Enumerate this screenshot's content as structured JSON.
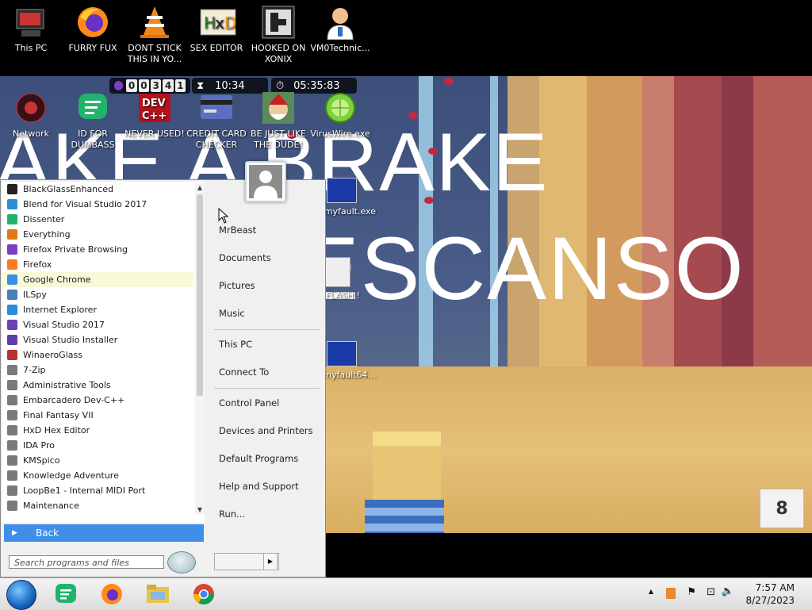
{
  "desktop_top_icons": [
    {
      "label": "This PC",
      "icon": "computer-icon"
    },
    {
      "label": "FURRY FUX",
      "icon": "firefox-icon"
    },
    {
      "label": "DONT STICK THIS IN YO...",
      "icon": "vlc-cone-icon"
    },
    {
      "label": "SEX EDITOR",
      "icon": "hex-editor-icon"
    },
    {
      "label": "HOOKED ON XONIX",
      "icon": "game-icon"
    },
    {
      "label": "VM0Technic...",
      "icon": "doctor-icon"
    }
  ],
  "desktop_mid_icons": [
    {
      "label": "Network",
      "icon": "network-icon"
    },
    {
      "label": "ID FOR DUMBASS",
      "icon": "chat-icon"
    },
    {
      "label": "NEVER USED!",
      "icon": "devcpp-icon"
    },
    {
      "label": "CREDIT CARD CHECKER",
      "icon": "card-icon"
    },
    {
      "label": "BE JUST LIKE THE DUDE!",
      "icon": "santa-icon"
    },
    {
      "label": "VirusWire.exe",
      "icon": "limewire-icon"
    }
  ],
  "desktop_right_icons": [
    {
      "label": "myfault.exe"
    },
    {
      "label": "FLASH !"
    },
    {
      "label": "myfault64..."
    }
  ],
  "game": {
    "banner_line1": "AKE A BRAKE",
    "banner_line2": "ESCANSO",
    "counter_digits": [
      "0",
      "0",
      "3",
      "4",
      "1"
    ],
    "timer": "10:34",
    "elapsed": "05:35:83",
    "corner_number": "8"
  },
  "start_menu": {
    "programs": [
      {
        "label": "BlackGlassEnhanced",
        "color": "#222222"
      },
      {
        "label": "Blend for Visual Studio 2017",
        "color": "#2c8fd6"
      },
      {
        "label": "Dissenter",
        "color": "#21b36b"
      },
      {
        "label": "Everything",
        "color": "#e07a14"
      },
      {
        "label": "Firefox Private Browsing",
        "color": "#7b3fc4"
      },
      {
        "label": "Firefox",
        "color": "#ff7a1a"
      },
      {
        "label": "Google Chrome",
        "color": "#3b8ee8"
      },
      {
        "label": "ILSpy",
        "color": "#4a7fb8"
      },
      {
        "label": "Internet Explorer",
        "color": "#2a8bd8"
      },
      {
        "label": "Visual Studio 2017",
        "color": "#6a3fb8"
      },
      {
        "label": "Visual Studio Installer",
        "color": "#5b3fa8"
      },
      {
        "label": "WinaeroGlass",
        "color": "#b83030"
      },
      {
        "label": "7-Zip",
        "color": "#7a7a7a"
      },
      {
        "label": "Administrative Tools",
        "color": "#7a7a7a"
      },
      {
        "label": "Embarcadero Dev-C++",
        "color": "#7a7a7a"
      },
      {
        "label": "Final Fantasy VII",
        "color": "#7a7a7a"
      },
      {
        "label": "HxD Hex Editor",
        "color": "#7a7a7a"
      },
      {
        "label": "IDA Pro",
        "color": "#7a7a7a"
      },
      {
        "label": "KMSpico",
        "color": "#7a7a7a"
      },
      {
        "label": "Knowledge Adventure",
        "color": "#7a7a7a"
      },
      {
        "label": "LoopBe1 - Internal MIDI Port",
        "color": "#7a7a7a"
      },
      {
        "label": "Maintenance",
        "color": "#7a7a7a"
      }
    ],
    "highlighted_program": "Google Chrome",
    "back_label": "Back",
    "search_placeholder": "Search programs and files",
    "right_items": [
      "MrBeast",
      "Documents",
      "Pictures",
      "Music",
      "This PC",
      "Connect To",
      "Control Panel",
      "Devices and Printers",
      "Default Programs",
      "Help and Support",
      "Run..."
    ]
  },
  "taskbar": {
    "pinned": [
      "dissenter-icon",
      "firefox-icon",
      "file-explorer-icon",
      "chrome-icon"
    ],
    "time": "7:57 AM",
    "date": "8/27/2023"
  },
  "colors": {
    "start_button": "#1565c0",
    "back_highlight": "#3f8fe8",
    "hover_highlight": "#f7f9d9"
  }
}
